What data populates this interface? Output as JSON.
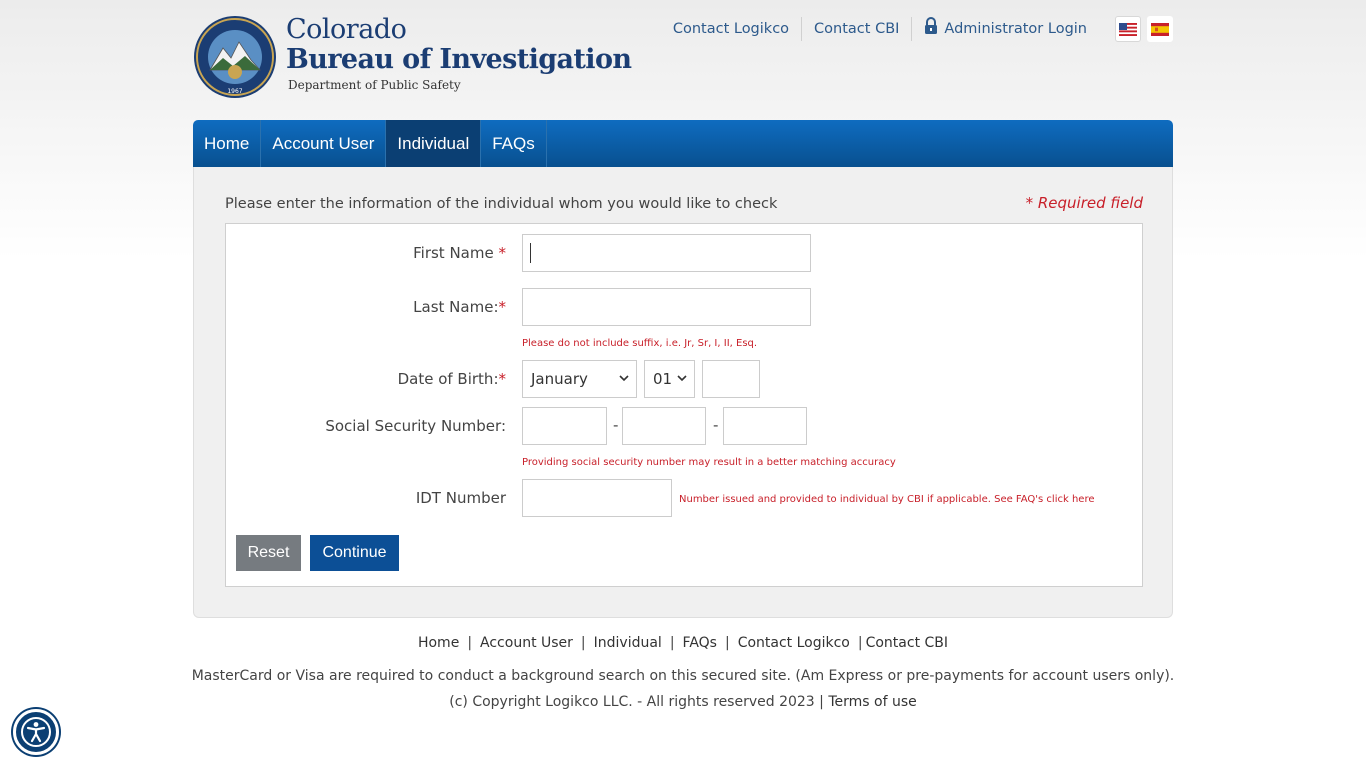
{
  "header": {
    "seal_text": "COLORADO BUREAU OF INVESTIGATION",
    "seal_year": "1967",
    "title_line1": "Colorado",
    "title_line2": "Bureau of Investigation",
    "title_line3": "Department of Public Safety",
    "links": {
      "contact_logikco": "Contact Logikco",
      "contact_cbi": "Contact CBI",
      "admin_login": "Administrator Login"
    },
    "flags": [
      "us-flag-icon",
      "spain-flag-icon"
    ]
  },
  "nav": {
    "tabs": [
      {
        "label": "Home",
        "active": false
      },
      {
        "label": "Account User",
        "active": false
      },
      {
        "label": "Individual",
        "active": true
      },
      {
        "label": "FAQs",
        "active": false
      }
    ]
  },
  "form": {
    "intro": "Please enter the information of the individual whom you would like to check",
    "required_note": "* Required field",
    "first_name_label": "First Name",
    "last_name_label": "Last Name:",
    "last_name_hint": "Please do not include suffix, i.e. Jr, Sr, I, II, Esq.",
    "dob_label": "Date of Birth:",
    "dob_month": "January",
    "dob_day": "01",
    "ssn_label": "Social Security Number:",
    "ssn_dash": "-",
    "ssn_hint": "Providing social security number may result in a better matching accuracy",
    "idt_label": "IDT Number",
    "idt_hint": "Number issued and provided to individual by CBI if applicable. See FAQ's click here",
    "star": "*",
    "reset_label": "Reset",
    "continue_label": "Continue"
  },
  "footer": {
    "links": [
      "Home",
      "Account User",
      "Individual",
      "FAQs",
      "Contact Logikco",
      "Contact CBI"
    ],
    "separator": "|",
    "note": "MasterCard or Visa are required to conduct a background search on this secured site. (Am Express or pre-payments for account users only).",
    "copyright": "(c) Copyright Logikco LLC. - All rights reserved 2023",
    "terms": "Terms of use"
  },
  "colors": {
    "brand_blue": "#1b3d73",
    "nav_blue": "#0f6cc0",
    "active_tab": "#0b3f73",
    "required_red": "#c8202a"
  }
}
